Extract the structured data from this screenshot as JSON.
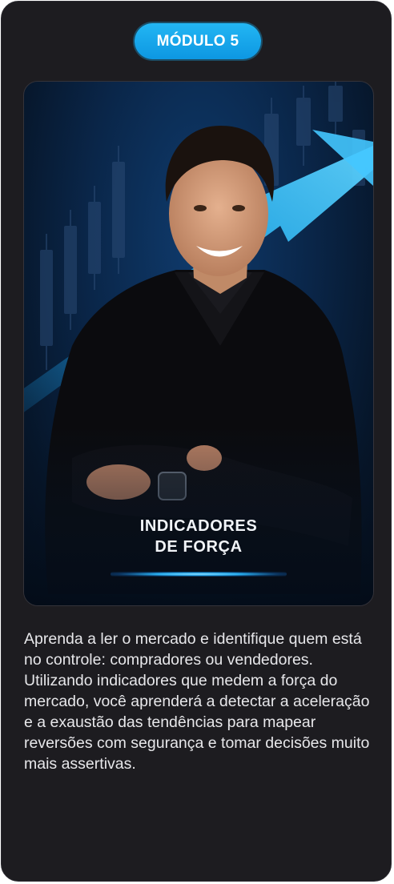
{
  "card": {
    "module_label": "MÓDULO 5",
    "hero": {
      "image": "portrait-man-black-blazer-trading-chart-background",
      "title_line1": "INDICADORES",
      "title_line2": "DE FORÇA"
    },
    "description": "Aprenda a ler o mercado e identifique quem está no controle: compradores ou vendedores. Utilizando indicadores que medem a força do mercado, você aprenderá a detectar a aceleração e a exaustão das tendências para mapear reversões com segurança e tomar decisões muito mais assertivas."
  },
  "colors": {
    "card_background": "#1d1c20",
    "badge_blue": "#1aa9ec",
    "hero_navy": "#0a2649",
    "accent_cyan": "#28aef0"
  }
}
